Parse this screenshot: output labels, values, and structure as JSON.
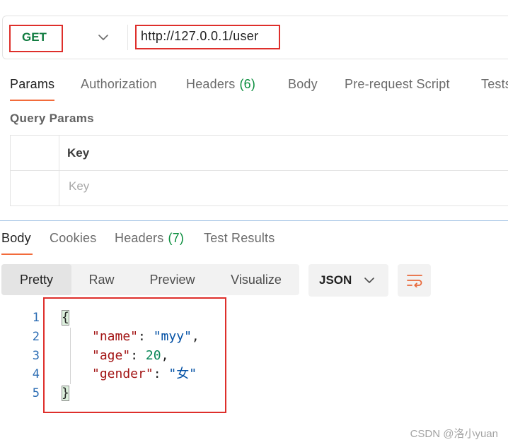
{
  "request": {
    "method": "GET",
    "url": "http://127.0.0.1/user",
    "tabs": [
      {
        "label": "Params",
        "active": true
      },
      {
        "label": "Authorization",
        "active": false
      },
      {
        "label": "Headers",
        "count": "(6)",
        "active": false
      },
      {
        "label": "Body",
        "active": false
      },
      {
        "label": "Pre-request Script",
        "active": false
      },
      {
        "label": "Tests",
        "active": false
      }
    ],
    "query_params": {
      "title": "Query Params",
      "columns": [
        "Key"
      ],
      "rows": [
        {
          "key_placeholder": "Key"
        }
      ]
    }
  },
  "response": {
    "tabs": [
      {
        "label": "Body",
        "active": true
      },
      {
        "label": "Cookies",
        "active": false
      },
      {
        "label": "Headers",
        "count": "(7)",
        "active": false
      },
      {
        "label": "Test Results",
        "active": false
      }
    ],
    "view_modes": [
      {
        "label": "Pretty",
        "selected": true
      },
      {
        "label": "Raw",
        "selected": false
      },
      {
        "label": "Preview",
        "selected": false
      },
      {
        "label": "Visualize",
        "selected": false
      }
    ],
    "format": "JSON",
    "code": {
      "lines": [
        {
          "number": "1",
          "tokens": [
            "{"
          ]
        },
        {
          "number": "2",
          "tokens": [
            "\"name\"",
            ": ",
            "\"myy\"",
            ","
          ]
        },
        {
          "number": "3",
          "tokens": [
            "\"age\"",
            ": ",
            "20",
            ","
          ]
        },
        {
          "number": "4",
          "tokens": [
            "\"gender\"",
            ": ",
            "\"女\""
          ]
        },
        {
          "number": "5",
          "tokens": [
            "}"
          ]
        }
      ]
    }
  },
  "watermark": "CSDN @洛小yuan",
  "icons": {
    "method_dropdown": "chevron-down-icon",
    "format_dropdown": "chevron-down-icon",
    "wrap_button": "wrap-lines-icon"
  },
  "colors": {
    "accent": "#f26b3a",
    "method_get": "#0f7b3f",
    "count_badge": "#0b8e3e",
    "annotation": "#de2f2b",
    "json_key": "#a31515",
    "json_string": "#0451a5",
    "json_number": "#098658",
    "line_number": "#2b6cb3",
    "separator": "#a7c6e6"
  }
}
